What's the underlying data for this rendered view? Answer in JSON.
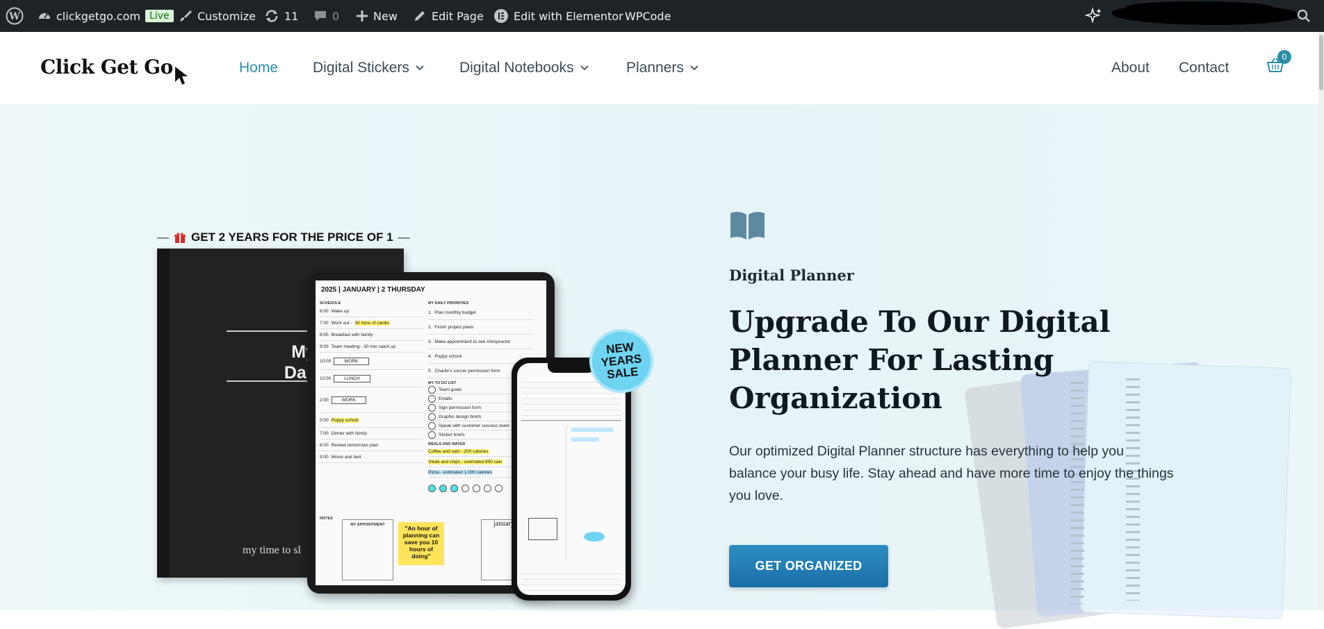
{
  "admin_bar": {
    "site_name": "clickgetgo.com",
    "live_badge": "Live",
    "customize": "Customize",
    "updates_count": "11",
    "comments_count": "0",
    "new": "New",
    "edit_page": "Edit Page",
    "edit_with_elementor": "Edit with Elementor",
    "wpcode": "WPCode"
  },
  "header": {
    "logo_text": "Click Get Go",
    "nav": [
      {
        "label": "Home",
        "active": true
      },
      {
        "label": "Digital Stickers",
        "dropdown": true
      },
      {
        "label": "Digital Notebooks",
        "dropdown": true
      },
      {
        "label": "Planners",
        "dropdown": true
      }
    ],
    "right_nav": [
      {
        "label": "About"
      },
      {
        "label": "Contact"
      }
    ],
    "cart_count": "0"
  },
  "hero": {
    "promo_text": "GET 2 YEARS FOR THE PRICE OF 1",
    "cover_title_line1": "My 202",
    "cover_title_line2": "Daily Pla",
    "cover_tagline": "my time to sl",
    "tablet_header": "2025 | JANUARY | 2 THURSDAY",
    "schedule": [
      {
        "time": "6:00",
        "text": "Wake up"
      },
      {
        "time": "7:00",
        "text": "Work out - 30 mins of cardio",
        "highlight": "30 mins of cardio"
      },
      {
        "time": "8:00",
        "text": "Breakfast with family"
      },
      {
        "time": "9:00",
        "text": "Team meeting - 30 min catch up"
      },
      {
        "time": "10:00",
        "text": "WORK"
      },
      {
        "time": "12:00",
        "text": "LUNCH"
      },
      {
        "time": "2:00",
        "text": "WORK"
      },
      {
        "time": "5:00",
        "text": "Puppy school"
      },
      {
        "time": "7:00",
        "text": "Dinner with family"
      },
      {
        "time": "8:00",
        "text": "Review tomorrows plan"
      },
      {
        "time": "9:00",
        "text": "Movie and bed"
      }
    ],
    "priorities_label": "MY DAILY PRIORITIES",
    "priorities": [
      "Plan monthly budget",
      "Finish project plans",
      "Make appointment to see chiropractor",
      "Puppy school",
      "Charlie's soccer permission form"
    ],
    "todo_label": "MY TO DO LIST",
    "todo": [
      "Team goals",
      "Emails",
      "Sign permission form",
      "Graphic design briefs",
      "Speak with customer success team",
      "Sticker briefs"
    ],
    "meals_label": "MEALS AND WATER",
    "meals": [
      "Coffee and oats - 200 calories",
      "Steak and chips - estimated 850 calo",
      "Pizza - estimated 1,000 calories"
    ],
    "notes_label": "NOTES",
    "appointment_label": "MY APPOINTMENT",
    "quote": "\"An hour of planning can save you 10 hours of doing\"",
    "calendar_label": "january",
    "badge_text": "NEW YEARS SALE",
    "eyebrow": "Digital Planner",
    "headline": "Upgrade To Our Digital Planner For Lasting Organization",
    "description": "Our optimized Digital Planner structure has everything to help you balance your busy life. Stay ahead and have more time to enjoy the things you love.",
    "cta_label": "GET ORGANIZED"
  },
  "colors": {
    "accent": "#2c8ea6",
    "admin_bg": "#1d2327",
    "cta": "#1b6fa8",
    "hero_bg": "#eaf6f8"
  }
}
